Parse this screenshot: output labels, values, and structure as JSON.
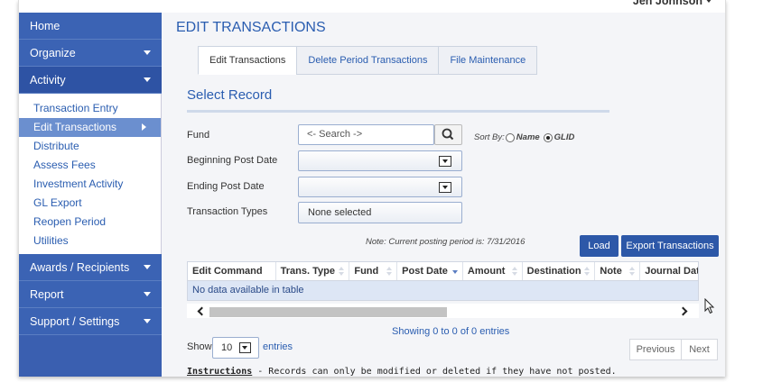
{
  "user": {
    "name": "Jen Johnson"
  },
  "sidebar": {
    "home": "Home",
    "organize": "Organize",
    "activity": "Activity",
    "activity_items": [
      "Transaction Entry",
      "Edit Transactions",
      "Distribute",
      "Assess Fees",
      "Investment Activity",
      "GL Export",
      "Reopen Period",
      "Utilities"
    ],
    "awards": "Awards / Recipients",
    "report": "Report",
    "support": "Support / Settings"
  },
  "page": {
    "title": "EDIT TRANSACTIONS",
    "tabs": [
      "Edit Transactions",
      "Delete Period Transactions",
      "File Maintenance"
    ],
    "section_title": "Select Record"
  },
  "form": {
    "fund_label": "Fund",
    "search_placeholder": "<- Search ->",
    "sort_by_label": "Sort By:",
    "sort_options": [
      "Name",
      "GLID"
    ],
    "sort_selected": "GLID",
    "beginning_post_date_label": "Beginning Post Date",
    "ending_post_date_label": "Ending Post Date",
    "transaction_types_label": "Transaction Types",
    "transaction_types_value": "None selected"
  },
  "note": "Note: Current posting period is: 7/31/2016",
  "buttons": {
    "load": "Load",
    "export": "Export Transactions"
  },
  "table": {
    "columns": [
      "Edit Command",
      "Trans. Type",
      "Fund",
      "Post Date",
      "Amount",
      "Destination",
      "Note",
      "Journal Date"
    ],
    "sorted_column": "Post Date",
    "empty_message": "No data available in table",
    "info": "Showing 0 to 0 of 0 entries",
    "show_label": "Show",
    "page_length": "10",
    "entries_label": "entries",
    "previous": "Previous",
    "next": "Next"
  },
  "instructions": {
    "heading": "Instructions",
    "text": " - Records can only be modified or deleted if they have not posted."
  }
}
